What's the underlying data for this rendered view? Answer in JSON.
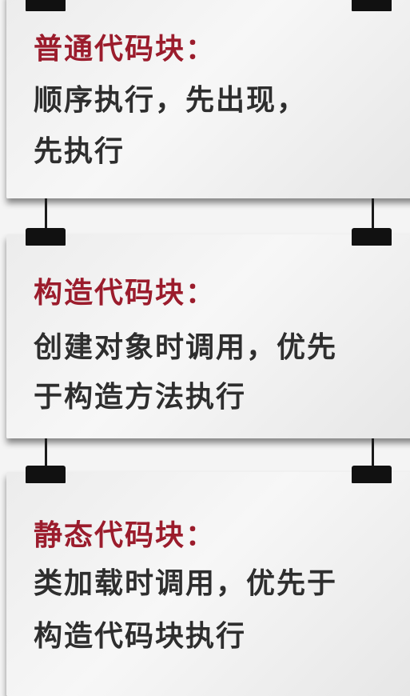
{
  "cards": [
    {
      "title": "普通代码块：",
      "lines": [
        "顺序执行，先出现，",
        "先执行"
      ]
    },
    {
      "title": "构造代码块：",
      "lines": [
        "创建对象时调用，优先",
        "于构造方法执行"
      ]
    },
    {
      "title": "静态代码块：",
      "lines": [
        "类加载时调用，优先于",
        "构造代码块执行"
      ]
    }
  ],
  "colors": {
    "title": "#9b1c2c",
    "body": "#2e2e2e"
  }
}
